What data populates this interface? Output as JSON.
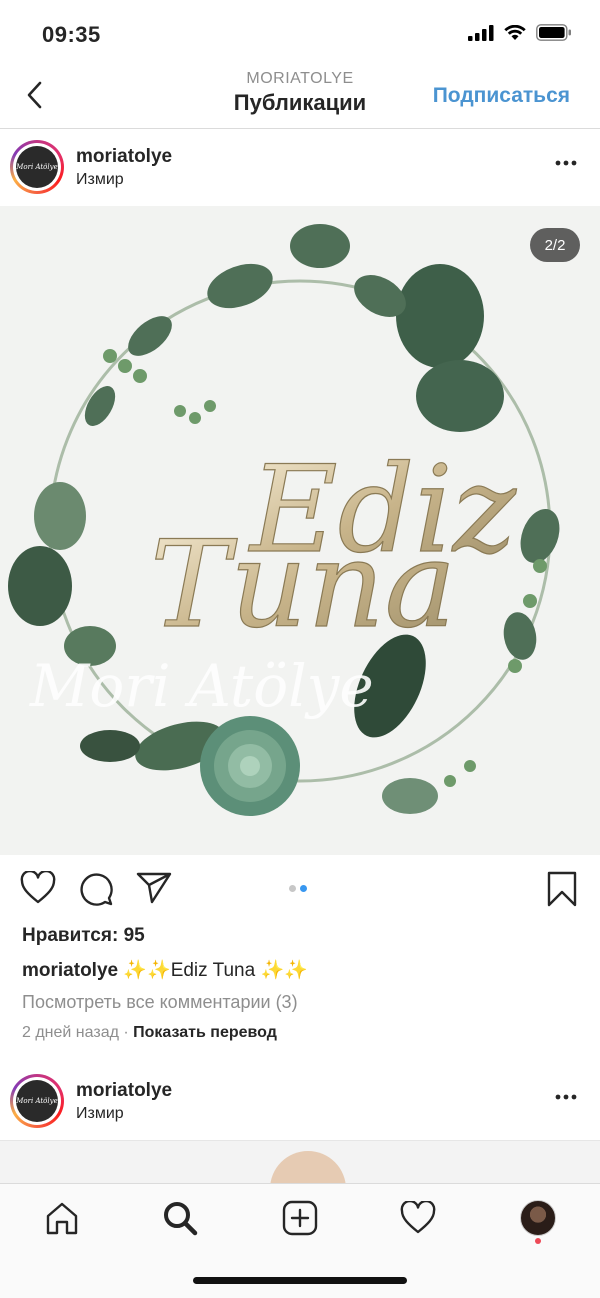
{
  "status_bar": {
    "time": "09:35"
  },
  "header": {
    "subtitle": "MORIATOLYE",
    "title": "Публикации",
    "subscribe_label": "Подписаться"
  },
  "posts": [
    {
      "username": "moriatolye",
      "location": "Измир",
      "avatar_text": "Mori Atölye",
      "image_counter": "2/2",
      "image_text": {
        "line1": "Ediz",
        "line2": "Tuna",
        "watermark": "Mori Atölye"
      },
      "carousel": {
        "count": 2,
        "active_index": 1
      },
      "likes": "Нравится: 95",
      "caption_user": "moriatolye",
      "caption_text": "✨✨Ediz Tuna ✨✨",
      "view_comments": "Посмотреть все комментарии (3)",
      "time_ago": "2 дней назад",
      "separator": " · ",
      "translate": "Показать перевод"
    },
    {
      "username": "moriatolye",
      "location": "Измир",
      "avatar_text": "Mori Atölye"
    }
  ],
  "tab_bar": {
    "items": [
      "home-icon",
      "search-icon",
      "add-post-icon",
      "activity-heart-icon",
      "profile-avatar"
    ],
    "active": "search-icon"
  },
  "colors": {
    "link_blue": "#4b94d1",
    "carousel_active": "#3897f0",
    "notification": "#ed4956"
  }
}
